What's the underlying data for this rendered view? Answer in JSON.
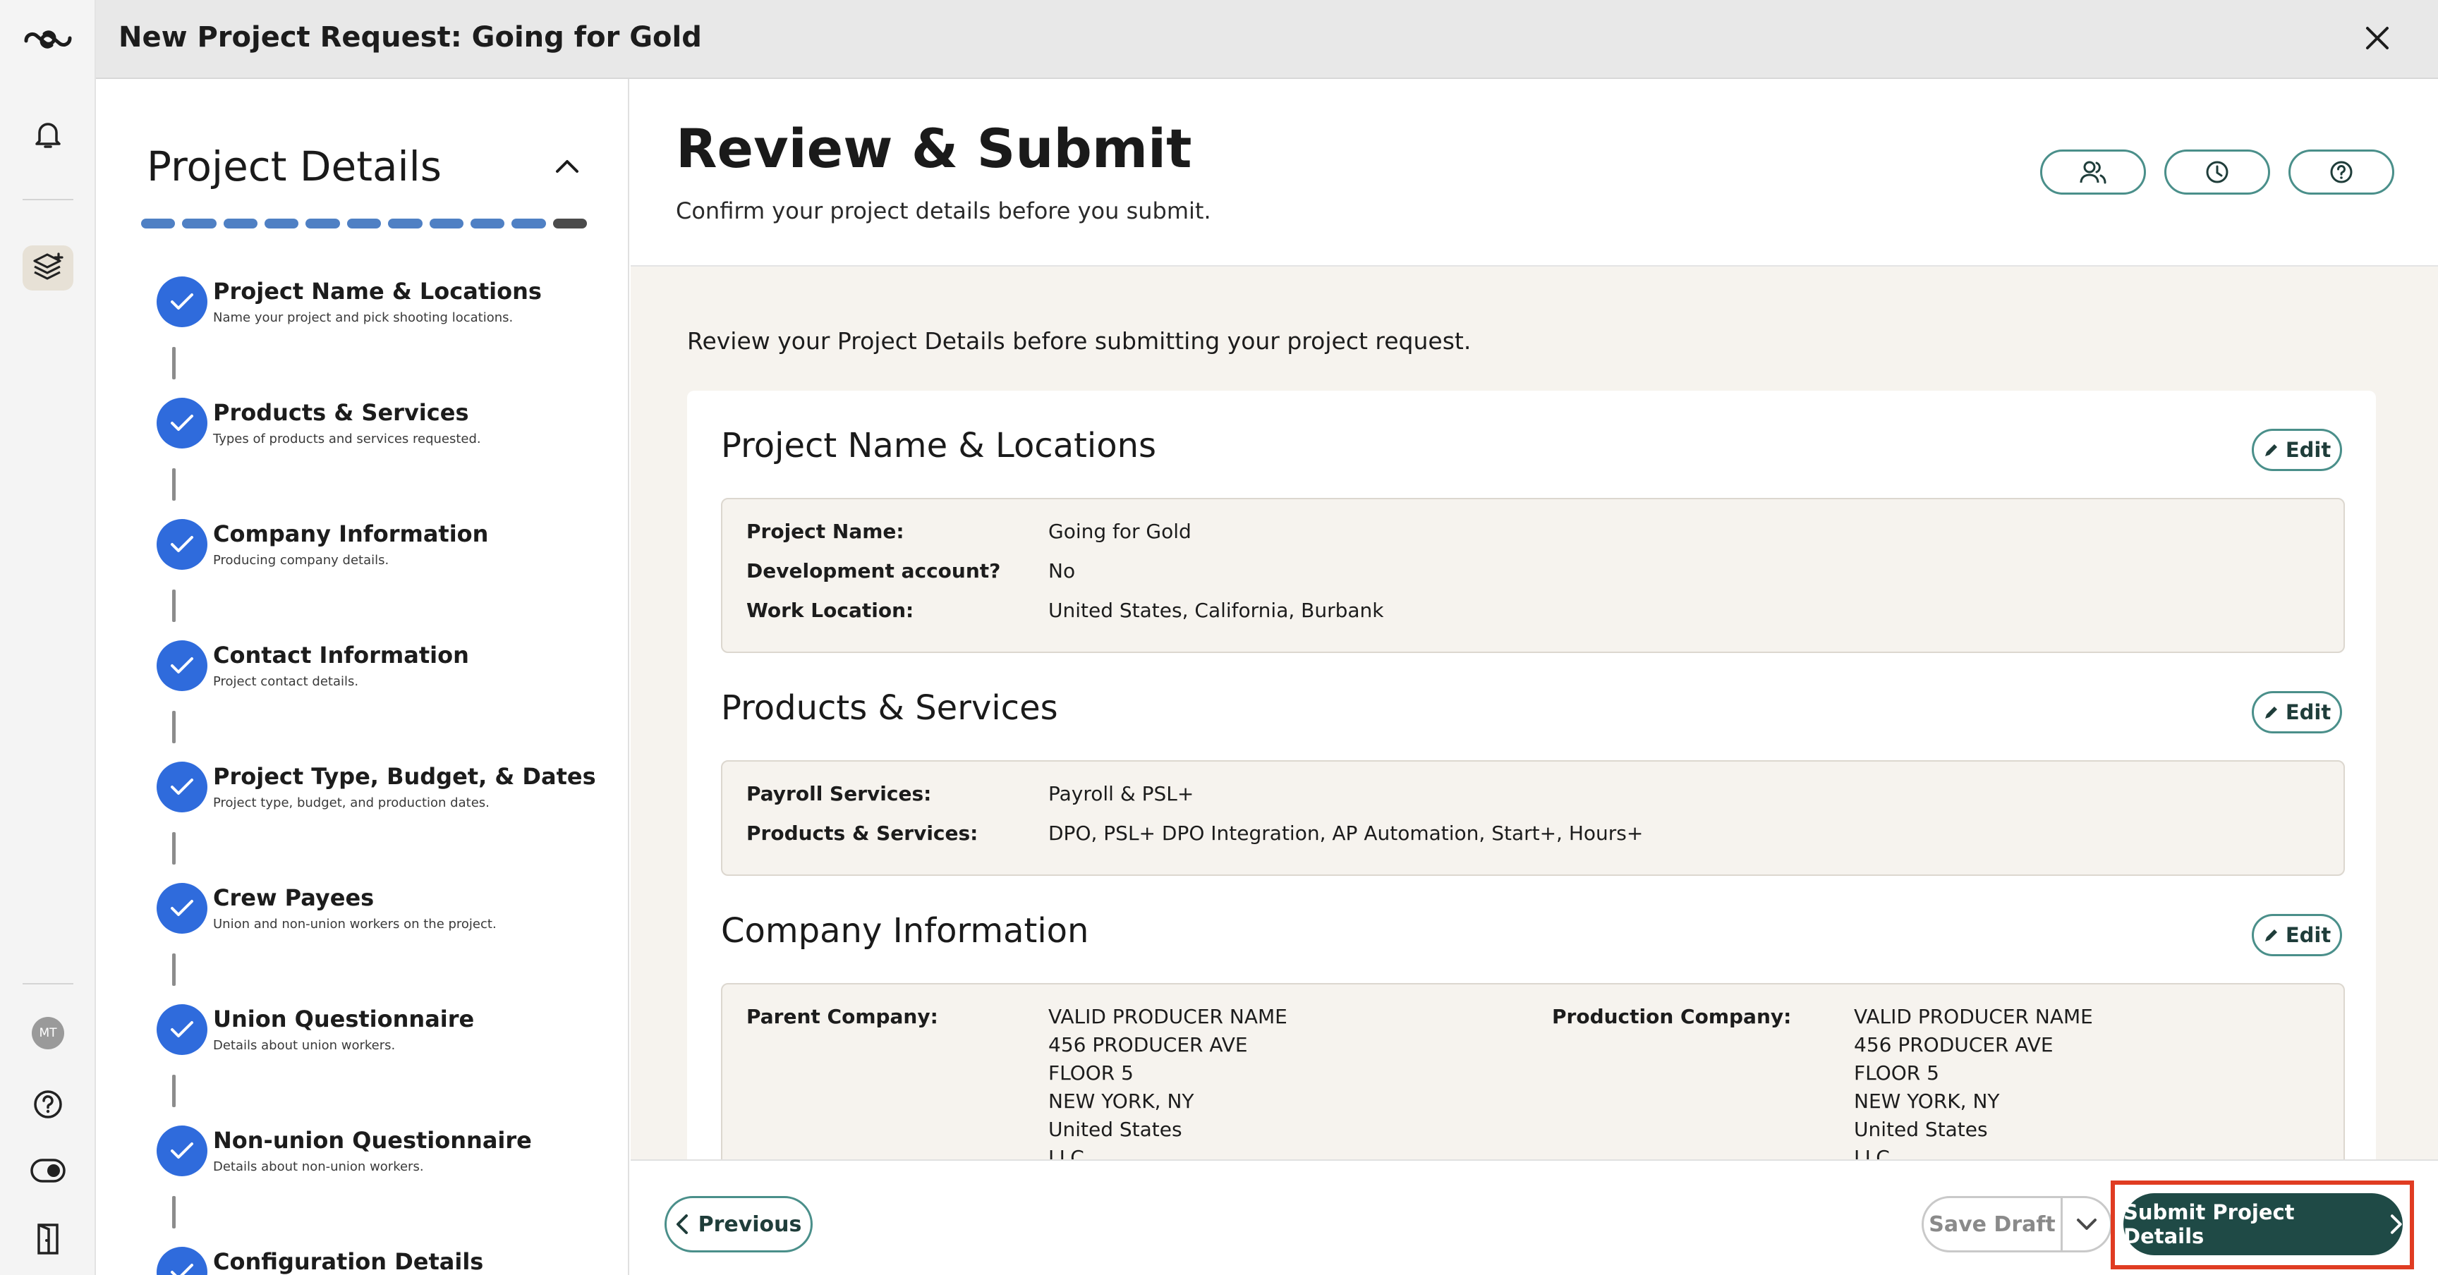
{
  "window": {
    "title": "New Project Request: Going for Gold",
    "close_icon": "close-icon"
  },
  "rail": {
    "avatar_initials": "MT",
    "icons": [
      "logo-icon",
      "bell-icon",
      "layers-plus-icon",
      "help-icon",
      "toggle-icon",
      "exit-door-icon"
    ]
  },
  "steps_panel": {
    "title": "Project Details",
    "progress_total": 11,
    "progress_complete": 10,
    "steps": [
      {
        "name": "Project Name & Locations",
        "desc": "Name your project and pick shooting locations."
      },
      {
        "name": "Products & Services",
        "desc": "Types of products and services requested."
      },
      {
        "name": "Company Information",
        "desc": "Producing company details."
      },
      {
        "name": "Contact Information",
        "desc": "Project contact details."
      },
      {
        "name": "Project Type, Budget, & Dates",
        "desc": "Project type, budget, and production dates."
      },
      {
        "name": "Crew Payees",
        "desc": "Union and non-union workers on the project."
      },
      {
        "name": "Union Questionnaire",
        "desc": "Details about union workers."
      },
      {
        "name": "Non-union Questionnaire",
        "desc": "Details about non-union workers."
      },
      {
        "name": "Configuration Details",
        "desc": ""
      }
    ]
  },
  "header": {
    "title": "Review & Submit",
    "subtitle": "Confirm your project details before you submit.",
    "buttons": [
      "people-icon",
      "clock-icon",
      "question-icon"
    ]
  },
  "content": {
    "intro": "Review your Project Details before submitting your project request.",
    "edit_label": "Edit",
    "sections": {
      "project": {
        "title": "Project Name & Locations",
        "rows": [
          {
            "k": "Project Name:",
            "v": "Going for Gold"
          },
          {
            "k": "Development account?",
            "v": "No"
          },
          {
            "k": "Work Location:",
            "v": "United States, California, Burbank"
          }
        ]
      },
      "products": {
        "title": "Products & Services",
        "rows": [
          {
            "k": "Payroll Services:",
            "v": "Payroll & PSL+"
          },
          {
            "k": "Products & Services:",
            "v": "DPO, PSL+ DPO Integration, AP Automation, Start+, Hours+"
          }
        ]
      },
      "company": {
        "title": "Company Information",
        "parent_label": "Parent Company:",
        "parent_address": [
          "VALID PRODUCER NAME",
          "456 PRODUCER AVE",
          "FLOOR 5",
          "NEW YORK, NY",
          "United States",
          "LLC"
        ],
        "production_label": "Production Company:",
        "production_address": [
          "VALID PRODUCER NAME",
          "456 PRODUCER AVE",
          "FLOOR 5",
          "NEW YORK, NY",
          "United States",
          "LLC"
        ]
      }
    }
  },
  "footer": {
    "previous": "Previous",
    "save_draft": "Save Draft",
    "submit": "Submit Project Details"
  },
  "colors": {
    "accent_teal": "#4a8f8a",
    "submit_bg": "#1f4a46",
    "step_blue": "#2f6bdc",
    "progress_blue": "#4f80c4",
    "highlight_red": "#e03c22"
  }
}
